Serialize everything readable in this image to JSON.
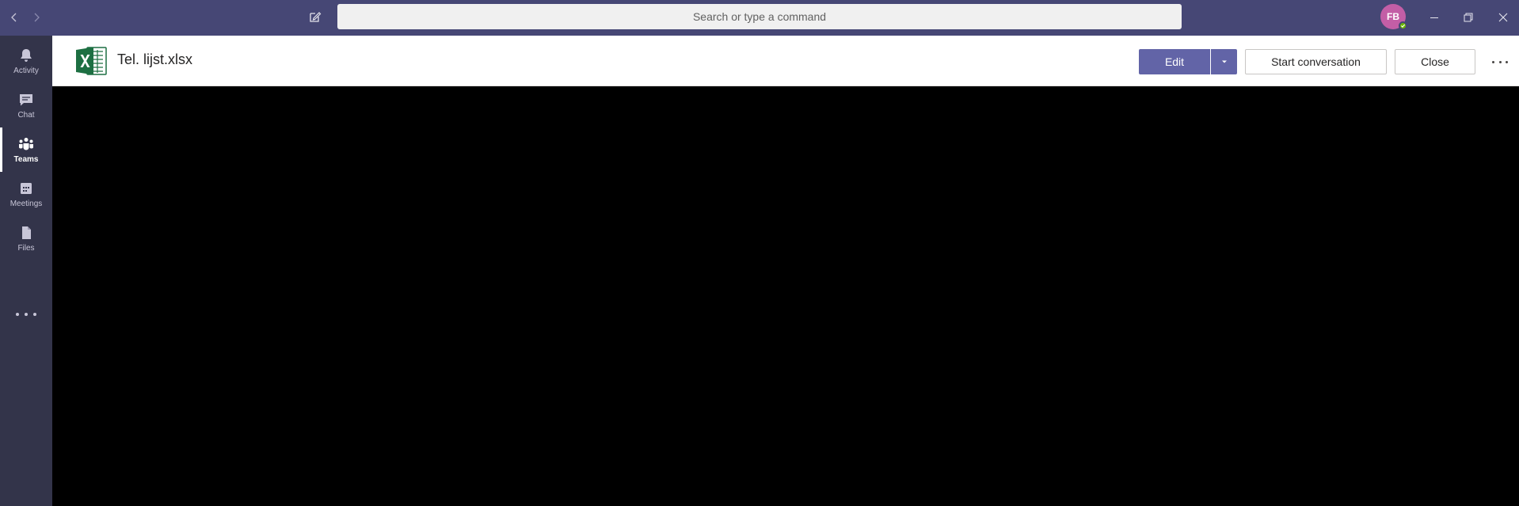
{
  "titlebar": {
    "search_placeholder": "Search or type a command",
    "avatar_initials": "FB",
    "bg_color": "#464775"
  },
  "rail": {
    "items": [
      {
        "label": "Activity",
        "icon": "bell-icon"
      },
      {
        "label": "Chat",
        "icon": "chat-icon"
      },
      {
        "label": "Teams",
        "icon": "teams-icon",
        "active": true
      },
      {
        "label": "Meetings",
        "icon": "calendar-icon"
      },
      {
        "label": "Files",
        "icon": "file-icon"
      }
    ]
  },
  "header": {
    "file_name": "Tel. lijst.xlsx",
    "edit_label": "Edit",
    "start_conversation_label": "Start conversation",
    "close_label": "Close"
  },
  "colors": {
    "accent": "#6264a7",
    "rail_bg": "#33344a",
    "excel_green": "#1d6f42"
  }
}
